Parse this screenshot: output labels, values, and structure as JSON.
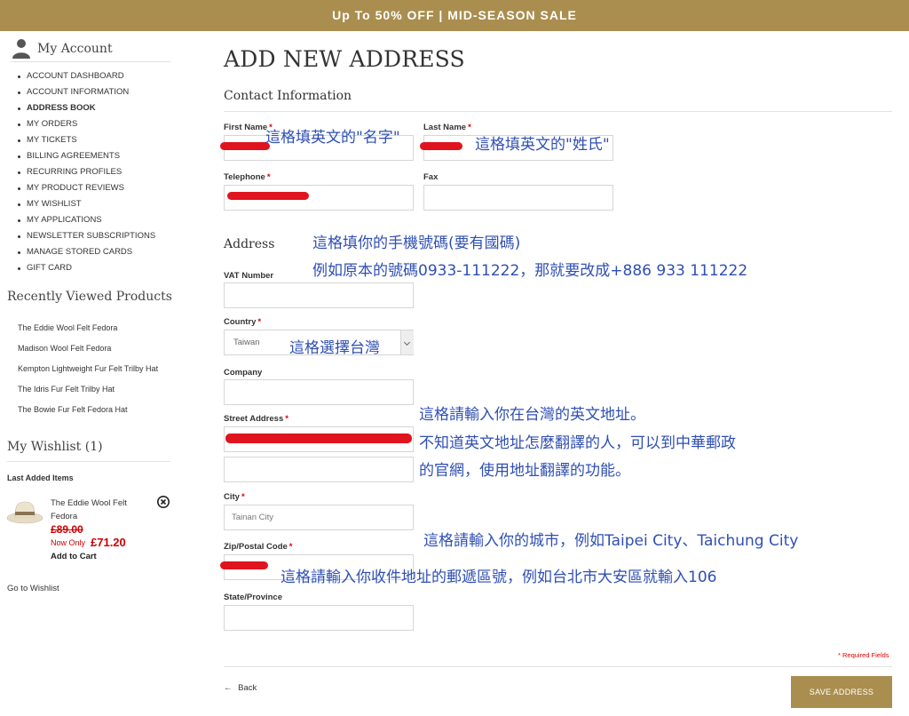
{
  "banner": {
    "text": "Up To 50% OFF | MID-SEASON SALE"
  },
  "sidebar": {
    "account_title": "My Account",
    "nav": [
      {
        "label": "ACCOUNT DASHBOARD"
      },
      {
        "label": "ACCOUNT INFORMATION"
      },
      {
        "label": "ADDRESS BOOK",
        "active": true
      },
      {
        "label": "MY ORDERS"
      },
      {
        "label": "MY TICKETS"
      },
      {
        "label": "BILLING AGREEMENTS"
      },
      {
        "label": "RECURRING PROFILES"
      },
      {
        "label": "MY PRODUCT REVIEWS"
      },
      {
        "label": "MY WISHLIST"
      },
      {
        "label": "MY APPLICATIONS"
      },
      {
        "label": "NEWSLETTER SUBSCRIPTIONS"
      },
      {
        "label": "MANAGE STORED CARDS"
      },
      {
        "label": "GIFT CARD"
      }
    ],
    "recently_viewed": {
      "title": "Recently Viewed Products",
      "items": [
        "The Eddie Wool Felt Fedora",
        "Madison Wool Felt Fedora",
        "Kempton Lightweight Fur Felt Trilby Hat",
        "The Idris Fur Felt Trilby Hat",
        "The Bowie Fur Felt Fedora Hat"
      ]
    },
    "wishlist": {
      "title": "My Wishlist (1)",
      "subtitle": "Last Added Items",
      "item_name": "The Eddie Wool Felt Fedora",
      "old_price": "£89.00",
      "now_label": "Now Only",
      "now_price": "£71.20",
      "add_to_cart": "Add to Cart",
      "go_link": "Go to Wishlist"
    }
  },
  "main": {
    "title": "ADD NEW ADDRESS",
    "contact_heading": "Contact Information",
    "address_heading": "Address",
    "labels": {
      "first_name": "First Name",
      "last_name": "Last Name",
      "telephone": "Telephone",
      "fax": "Fax",
      "vat": "VAT Number",
      "country": "Country",
      "company": "Company",
      "street": "Street Address",
      "city": "City",
      "zip": "Zip/Postal Code",
      "state": "State/Province"
    },
    "required_mark": "*",
    "values": {
      "country": "Taiwan",
      "city": "Tainan City"
    },
    "required_note": "* Required Fields",
    "back": "Back",
    "save": "SAVE ADDRESS"
  },
  "annotations": {
    "first_name": "這格填英文的\"名字\"",
    "last_name": "這格填英文的\"姓氏\"",
    "phone_line1": "這格填你的手機號碼(要有國碼)",
    "phone_line2": "例如原本的號碼0933-111222，那就要改成+886 933 111222",
    "country": "這格選擇台灣",
    "street_line1": "這格請輸入你在台灣的英文地址。",
    "street_line2": "不知道英文地址怎麼翻譯的人，可以到中華郵政",
    "street_line3": "的官網，使用地址翻譯的功能。",
    "city": "這格請輸入你的城市，例如Taipei City、Taichung City",
    "zip": "這格請輸入你收件地址的郵遞區號，例如台北市大安區就輸入106"
  },
  "colors": {
    "brand": "#aa8e4f",
    "required": "#dd0000",
    "annotation": "#2f4fb3",
    "redaction": "#e0141e"
  }
}
